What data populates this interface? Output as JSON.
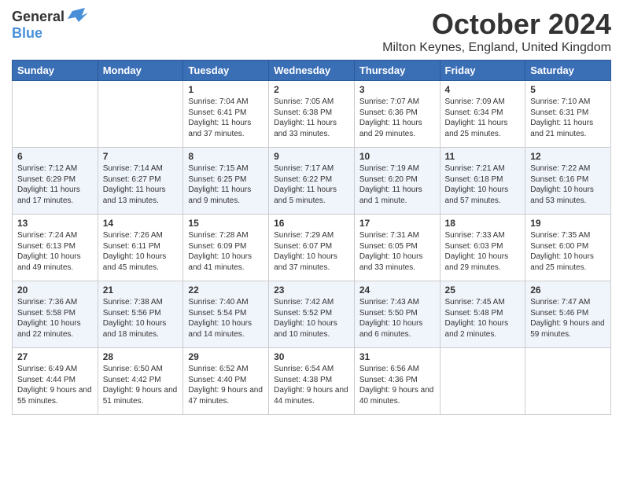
{
  "logo": {
    "general": "General",
    "blue": "Blue"
  },
  "title": "October 2024",
  "subtitle": "Milton Keynes, England, United Kingdom",
  "days_of_week": [
    "Sunday",
    "Monday",
    "Tuesday",
    "Wednesday",
    "Thursday",
    "Friday",
    "Saturday"
  ],
  "weeks": [
    [
      {
        "day": null
      },
      {
        "day": null
      },
      {
        "day": "1",
        "sunrise": "7:04 AM",
        "sunset": "6:41 PM",
        "daylight": "11 hours and 37 minutes."
      },
      {
        "day": "2",
        "sunrise": "7:05 AM",
        "sunset": "6:38 PM",
        "daylight": "11 hours and 33 minutes."
      },
      {
        "day": "3",
        "sunrise": "7:07 AM",
        "sunset": "6:36 PM",
        "daylight": "11 hours and 29 minutes."
      },
      {
        "day": "4",
        "sunrise": "7:09 AM",
        "sunset": "6:34 PM",
        "daylight": "11 hours and 25 minutes."
      },
      {
        "day": "5",
        "sunrise": "7:10 AM",
        "sunset": "6:31 PM",
        "daylight": "11 hours and 21 minutes."
      }
    ],
    [
      {
        "day": "6",
        "sunrise": "7:12 AM",
        "sunset": "6:29 PM",
        "daylight": "11 hours and 17 minutes."
      },
      {
        "day": "7",
        "sunrise": "7:14 AM",
        "sunset": "6:27 PM",
        "daylight": "11 hours and 13 minutes."
      },
      {
        "day": "8",
        "sunrise": "7:15 AM",
        "sunset": "6:25 PM",
        "daylight": "11 hours and 9 minutes."
      },
      {
        "day": "9",
        "sunrise": "7:17 AM",
        "sunset": "6:22 PM",
        "daylight": "11 hours and 5 minutes."
      },
      {
        "day": "10",
        "sunrise": "7:19 AM",
        "sunset": "6:20 PM",
        "daylight": "11 hours and 1 minute."
      },
      {
        "day": "11",
        "sunrise": "7:21 AM",
        "sunset": "6:18 PM",
        "daylight": "10 hours and 57 minutes."
      },
      {
        "day": "12",
        "sunrise": "7:22 AM",
        "sunset": "6:16 PM",
        "daylight": "10 hours and 53 minutes."
      }
    ],
    [
      {
        "day": "13",
        "sunrise": "7:24 AM",
        "sunset": "6:13 PM",
        "daylight": "10 hours and 49 minutes."
      },
      {
        "day": "14",
        "sunrise": "7:26 AM",
        "sunset": "6:11 PM",
        "daylight": "10 hours and 45 minutes."
      },
      {
        "day": "15",
        "sunrise": "7:28 AM",
        "sunset": "6:09 PM",
        "daylight": "10 hours and 41 minutes."
      },
      {
        "day": "16",
        "sunrise": "7:29 AM",
        "sunset": "6:07 PM",
        "daylight": "10 hours and 37 minutes."
      },
      {
        "day": "17",
        "sunrise": "7:31 AM",
        "sunset": "6:05 PM",
        "daylight": "10 hours and 33 minutes."
      },
      {
        "day": "18",
        "sunrise": "7:33 AM",
        "sunset": "6:03 PM",
        "daylight": "10 hours and 29 minutes."
      },
      {
        "day": "19",
        "sunrise": "7:35 AM",
        "sunset": "6:00 PM",
        "daylight": "10 hours and 25 minutes."
      }
    ],
    [
      {
        "day": "20",
        "sunrise": "7:36 AM",
        "sunset": "5:58 PM",
        "daylight": "10 hours and 22 minutes."
      },
      {
        "day": "21",
        "sunrise": "7:38 AM",
        "sunset": "5:56 PM",
        "daylight": "10 hours and 18 minutes."
      },
      {
        "day": "22",
        "sunrise": "7:40 AM",
        "sunset": "5:54 PM",
        "daylight": "10 hours and 14 minutes."
      },
      {
        "day": "23",
        "sunrise": "7:42 AM",
        "sunset": "5:52 PM",
        "daylight": "10 hours and 10 minutes."
      },
      {
        "day": "24",
        "sunrise": "7:43 AM",
        "sunset": "5:50 PM",
        "daylight": "10 hours and 6 minutes."
      },
      {
        "day": "25",
        "sunrise": "7:45 AM",
        "sunset": "5:48 PM",
        "daylight": "10 hours and 2 minutes."
      },
      {
        "day": "26",
        "sunrise": "7:47 AM",
        "sunset": "5:46 PM",
        "daylight": "9 hours and 59 minutes."
      }
    ],
    [
      {
        "day": "27",
        "sunrise": "6:49 AM",
        "sunset": "4:44 PM",
        "daylight": "9 hours and 55 minutes."
      },
      {
        "day": "28",
        "sunrise": "6:50 AM",
        "sunset": "4:42 PM",
        "daylight": "9 hours and 51 minutes."
      },
      {
        "day": "29",
        "sunrise": "6:52 AM",
        "sunset": "4:40 PM",
        "daylight": "9 hours and 47 minutes."
      },
      {
        "day": "30",
        "sunrise": "6:54 AM",
        "sunset": "4:38 PM",
        "daylight": "9 hours and 44 minutes."
      },
      {
        "day": "31",
        "sunrise": "6:56 AM",
        "sunset": "4:36 PM",
        "daylight": "9 hours and 40 minutes."
      },
      {
        "day": null
      },
      {
        "day": null
      }
    ]
  ]
}
